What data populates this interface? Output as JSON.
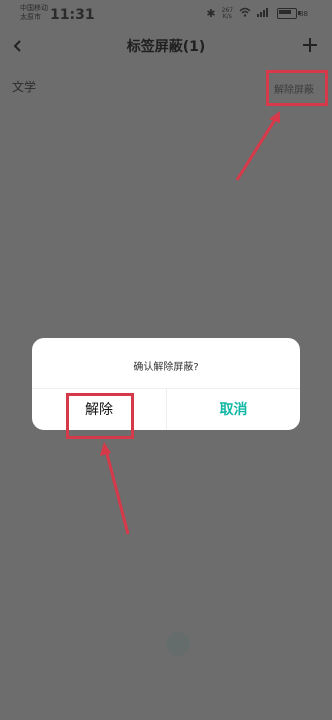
{
  "status_bar": {
    "carrier_line1": "中国移动",
    "carrier_line2": "太原市",
    "time": "11:31",
    "icons": [
      "bluetooth-icon",
      "network-speed-icon",
      "wifi-icon",
      "signal-icon",
      "battery-icon"
    ],
    "network_speed_text": "267\nK/s",
    "battery_text": "88"
  },
  "header": {
    "title": "标签屏蔽(1)",
    "back_icon": "chevron-left-icon",
    "add_icon": "plus-icon"
  },
  "tag_list": [
    {
      "name": "文学",
      "action_label": "解除屏蔽"
    }
  ],
  "dialog": {
    "message": "确认解除屏蔽?",
    "confirm_label": "解除",
    "cancel_label": "取消"
  },
  "colors": {
    "overlay_background": "#6d6d6d",
    "accent": "#14b8a6",
    "annotation": "#d63a4a",
    "dialog_background": "#ffffff"
  }
}
